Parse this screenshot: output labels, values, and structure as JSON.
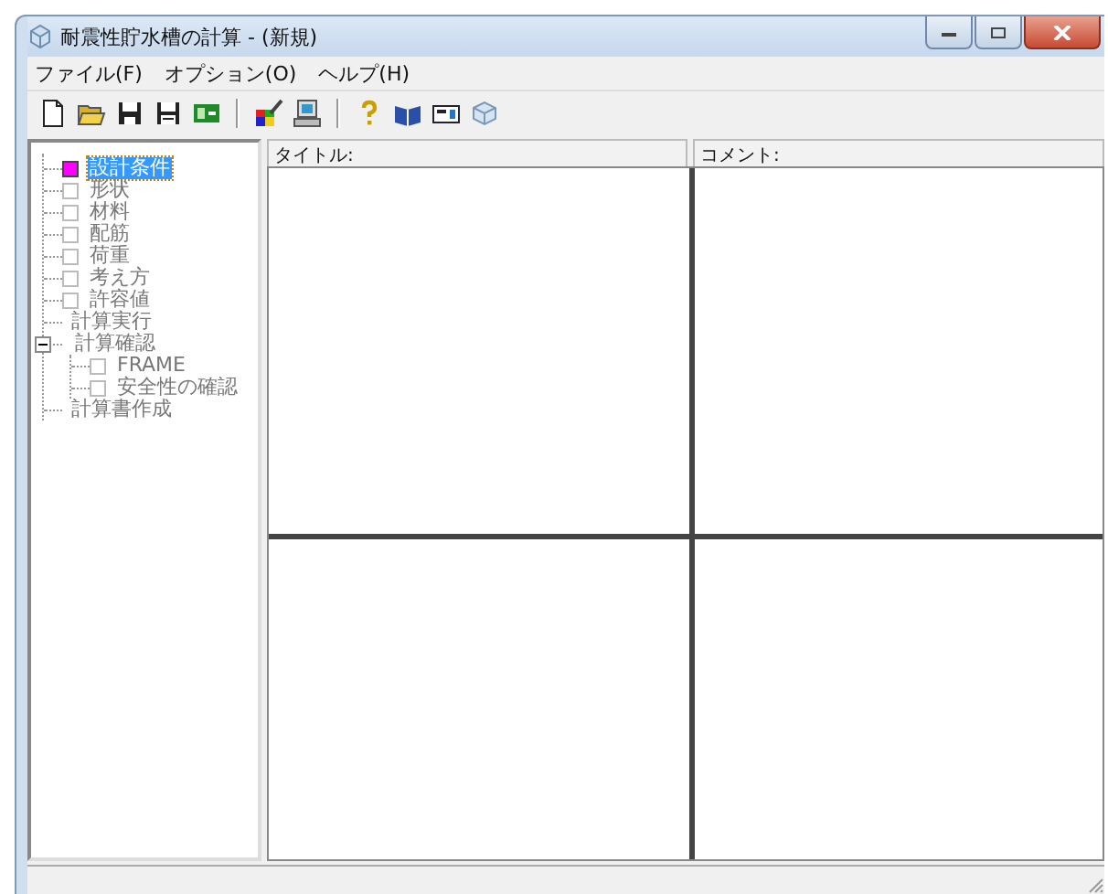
{
  "window": {
    "title": "耐震性貯水槽の計算 - (新規)"
  },
  "menu": [
    "ファイル(F)",
    "オプション(O)",
    "ヘルプ(H)"
  ],
  "tree": [
    {
      "label": "設計条件",
      "kind": "checkbox",
      "checked": true,
      "selected": true
    },
    {
      "label": "形状",
      "kind": "checkbox",
      "checked": false,
      "selected": false
    },
    {
      "label": "材料",
      "kind": "checkbox",
      "checked": false,
      "selected": false
    },
    {
      "label": "配筋",
      "kind": "checkbox",
      "checked": false,
      "selected": false
    },
    {
      "label": "荷重",
      "kind": "checkbox",
      "checked": false,
      "selected": false
    },
    {
      "label": "考え方",
      "kind": "checkbox",
      "checked": false,
      "selected": false
    },
    {
      "label": "許容値",
      "kind": "checkbox",
      "checked": false,
      "selected": false
    },
    {
      "label": "計算実行",
      "kind": "plain",
      "selected": false
    },
    {
      "label": "計算確認",
      "kind": "plain",
      "selected": false,
      "expanded": true,
      "children": [
        {
          "label": "FRAME",
          "kind": "checkbox",
          "checked": false,
          "selected": false
        },
        {
          "label": "安全性の確認",
          "kind": "checkbox",
          "checked": false,
          "selected": false
        }
      ]
    },
    {
      "label": "計算書作成",
      "kind": "plain",
      "selected": false
    }
  ],
  "panes": {
    "title_label": "タイトル:",
    "comment_label": "コメント:"
  }
}
